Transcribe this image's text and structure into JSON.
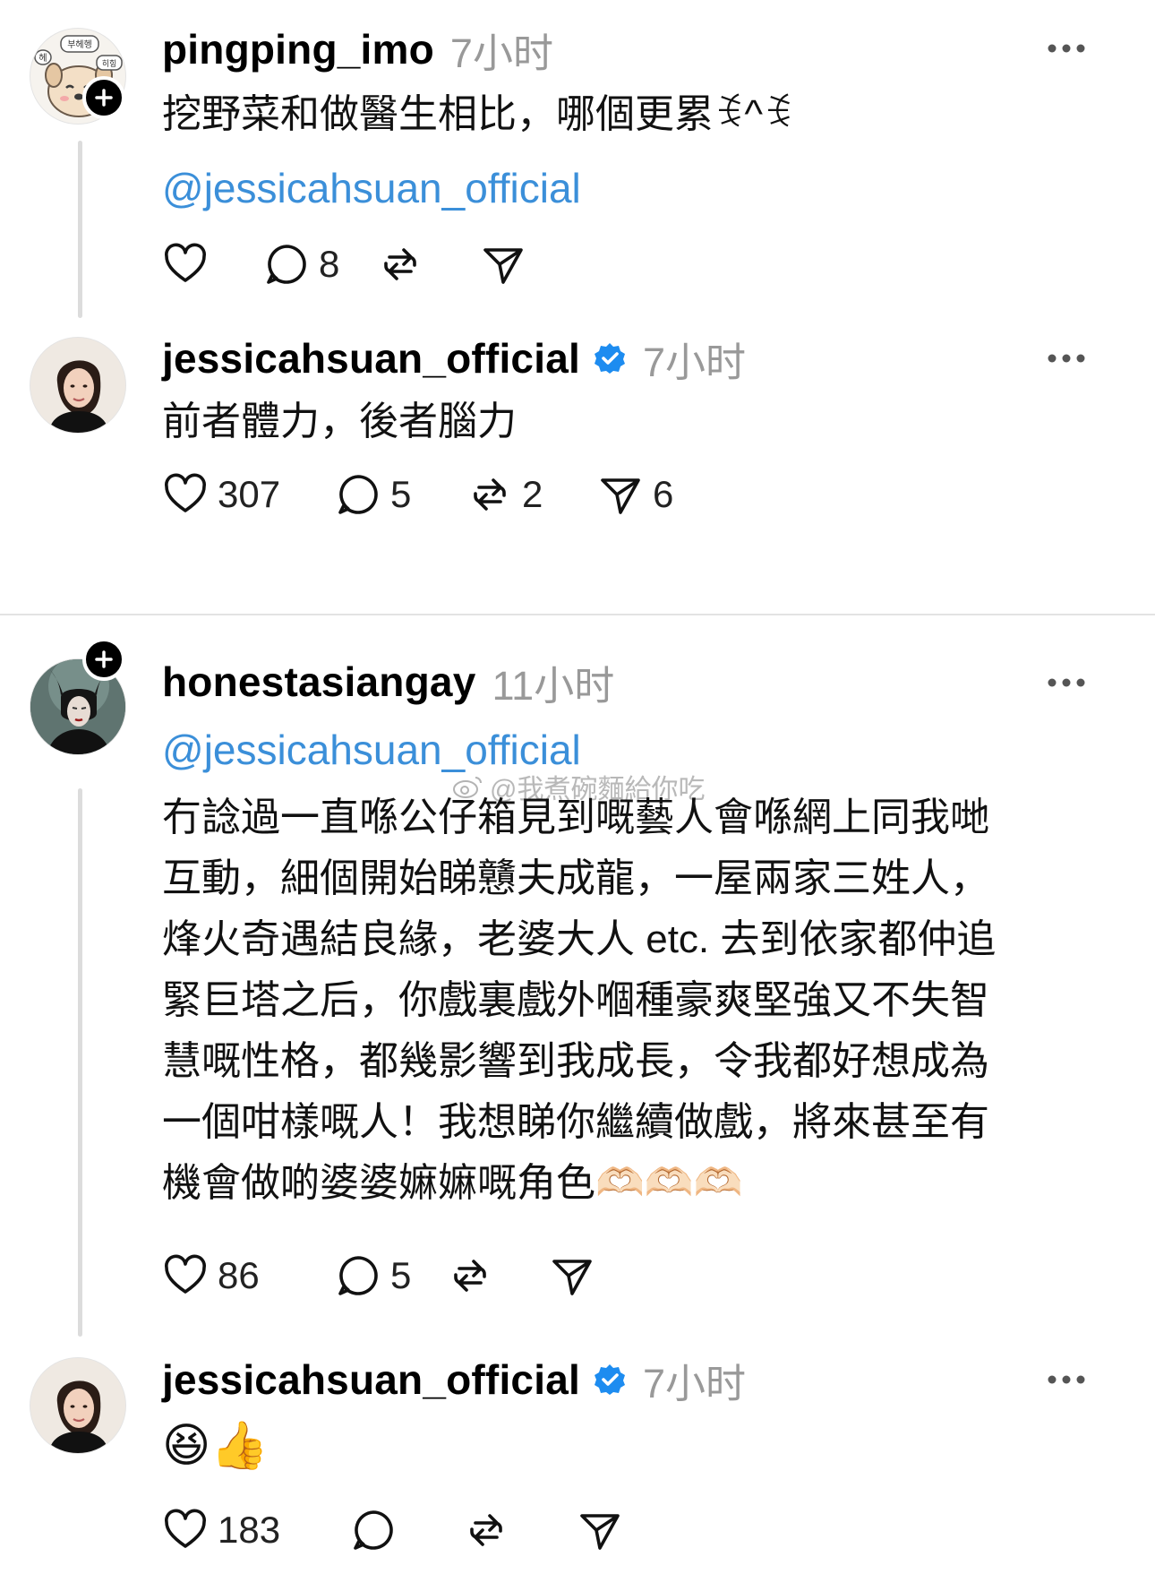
{
  "posts": [
    {
      "username": "pingping_imo",
      "time": "7小时",
      "text_lines": [
        "挖野菜和做醫生相比，哪個更累ꉂ^ꉂ"
      ],
      "mention": "@jessicahsuan_official",
      "actions": {
        "likes": "",
        "replies": "8",
        "reposts": "",
        "shares": ""
      },
      "avatar_icon": "cartoon-dog-avatar",
      "avatar_bubbles": [
        "부헤헹",
        "헤",
        "히힝"
      ],
      "follow_button": true
    },
    {
      "username": "jessicahsuan_official",
      "verified": true,
      "time": "7小时",
      "text_lines": [
        "前者體力，後者腦力"
      ],
      "actions": {
        "likes": "307",
        "replies": "5",
        "reposts": "2",
        "shares": "6"
      },
      "avatar_icon": "woman-portrait-avatar"
    },
    {
      "username": "honestasiangay",
      "time": "11小时",
      "mention": "@jessicahsuan_official",
      "text_lines": [
        "冇諗過一直喺公仔箱見到嘅藝人會喺網上同我哋",
        "互動，細個開始睇戇夫成龍，一屋兩家三姓人，",
        "烽火奇遇結良緣，老婆大人 etc. 去到依家都仲追",
        "緊巨塔之后，你戲裏戲外嗰種豪爽堅強又不失智",
        "慧嘅性格，都幾影響到我成長，令我都好想成為",
        "一個咁樣嘅人！我想睇你繼續做戲，將來甚至有",
        "機會做啲婆婆嫲嫲嘅角色🫶🏻🫶🏻🫶🏻"
      ],
      "actions": {
        "likes": "86",
        "replies": "5",
        "reposts": "",
        "shares": ""
      },
      "avatar_icon": "maleficent-avatar",
      "follow_button": true
    },
    {
      "username": "jessicahsuan_official",
      "verified": true,
      "time": "7小时",
      "text_lines": [
        "😆👍"
      ],
      "actions": {
        "likes": "183",
        "replies": "",
        "reposts": "",
        "shares": ""
      },
      "avatar_icon": "woman-portrait-avatar"
    }
  ],
  "watermark": "@我煮碗麵給你吃",
  "colors": {
    "mention": "#3b8fd9",
    "verified": "#1d8cf0",
    "muted": "#999999",
    "line": "#dcdcdc"
  }
}
